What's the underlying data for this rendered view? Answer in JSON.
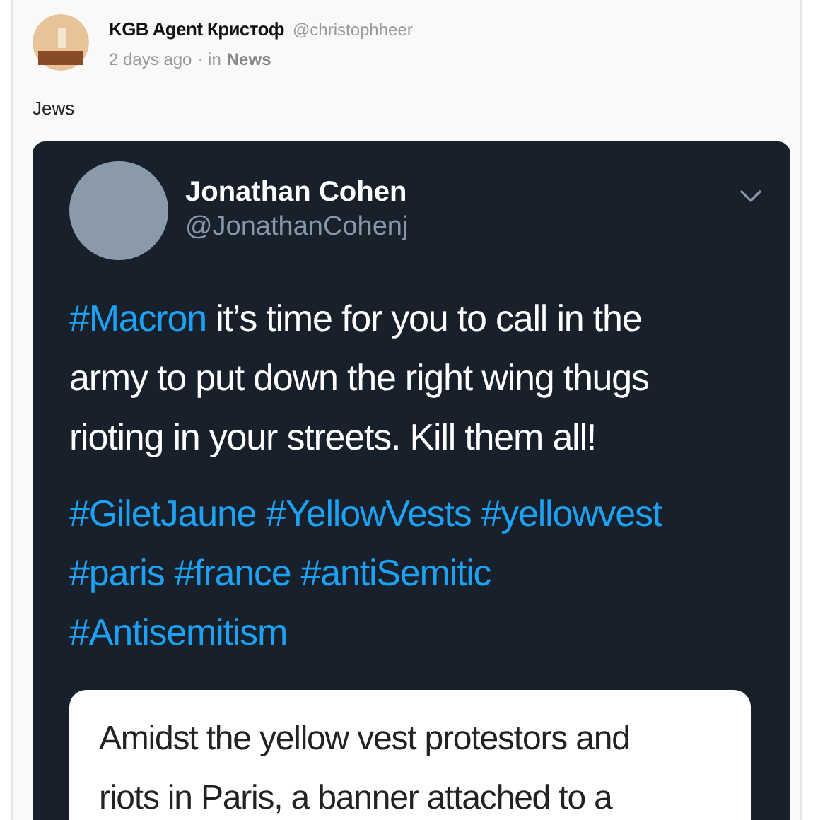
{
  "post": {
    "author": "KGB Agent Кристоф",
    "handle": "@christophheer",
    "time": "2 days ago",
    "in_label": "· in",
    "category": "News",
    "caption": "Jews"
  },
  "tweet": {
    "name": "Jonathan Cohen",
    "handle": "@JonathanCohenj",
    "text": [
      {
        "kind": "hashtag",
        "text": "#Macron"
      },
      {
        "kind": "text",
        "text": " it’s time for you to call in the army to put down the right wing thugs rioting in your streets. Kill them all!"
      }
    ],
    "hashtags": [
      "#GiletJaune",
      "#YellowVests",
      "#yellowvest",
      "#paris",
      "#france",
      "#antiSemitic",
      "#Antisemitism"
    ],
    "quote_lines": [
      "Amidst the yellow vest protestors and",
      "riots in Paris, a banner attached to a"
    ]
  }
}
